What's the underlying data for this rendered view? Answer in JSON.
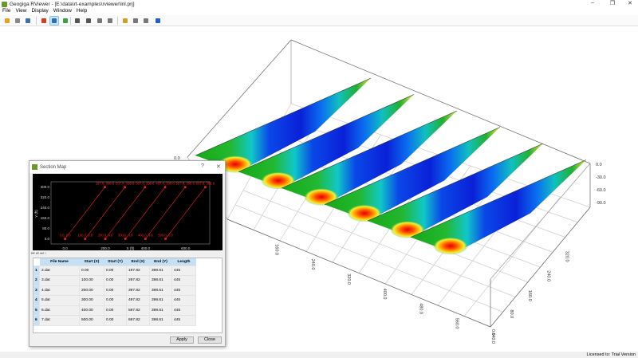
{
  "window": {
    "title": "Geogiga RViewer - [E:\\data\\rt-examples\\rviewer\\lnl.prj]",
    "minimize": "–",
    "maximize": "❐",
    "close": "✕"
  },
  "menu": [
    "File",
    "View",
    "Display",
    "Window",
    "Help"
  ],
  "toolbar": [
    {
      "name": "open-icon",
      "color": "#e8a020"
    },
    {
      "name": "print-icon",
      "color": "#888888"
    },
    {
      "name": "save-image-icon",
      "color": "#3a6fb0"
    },
    {
      "name": "color-scale-icon",
      "color": "#d04020"
    },
    {
      "name": "section-map-icon",
      "color": "#2a70c0",
      "active": true
    },
    {
      "name": "refresh-icon",
      "color": "#3aa040"
    },
    {
      "name": "zoom-in-icon",
      "color": "#555555"
    },
    {
      "name": "zoom-out-icon",
      "color": "#555555"
    },
    {
      "name": "zoom-window-icon",
      "color": "#777777"
    },
    {
      "name": "zoom-fit-icon",
      "color": "#777777"
    },
    {
      "name": "axis-icon",
      "color": "#d0a020"
    },
    {
      "name": "bt-icon",
      "color": "#777777"
    },
    {
      "name": "rt-icon",
      "color": "#777777"
    },
    {
      "name": "rotate-icon",
      "color": "#2060d0"
    }
  ],
  "view3d": {
    "x_axis_ticks": [
      "160.0",
      "240.0",
      "320.0",
      "400.0",
      "480.0",
      "560.0",
      "640.0"
    ],
    "y_axis_ticks": [
      "0.0",
      "80.0",
      "160.0",
      "240.0",
      "320.0"
    ],
    "z_axis_ticks": [
      "0.0",
      "-30.0",
      "-60.0",
      "-90.0"
    ],
    "left_label": "0.0",
    "sections": 6
  },
  "dialog": {
    "title": "Section Map",
    "help": "?",
    "close": "✕",
    "chart_data": {
      "type": "line",
      "xlabel": "X (ft)",
      "ylabel": "Y (ft)",
      "xlim": [
        -70,
        720
      ],
      "ylim": [
        -40,
        440
      ],
      "x_ticks": [
        "0.0",
        "200.0",
        "400.0",
        "600.0"
      ],
      "y_ticks": [
        "0.0",
        "80.0",
        "160.0",
        "240.0",
        "320.0",
        "400.0"
      ],
      "series": [
        {
          "x": [
            0,
            197.82
          ],
          "y": [
            0,
            398.61
          ],
          "start_label": "0.0, 0.0",
          "end_label": "197.8, 398.6"
        },
        {
          "x": [
            100,
            297.82
          ],
          "y": [
            0,
            398.61
          ],
          "start_label": "100.0, 0.0",
          "end_label": "297.8, 398.6"
        },
        {
          "x": [
            200,
            397.82
          ],
          "y": [
            0,
            398.61
          ],
          "start_label": "200.0, 0.0",
          "end_label": "397.8, 398.6"
        },
        {
          "x": [
            300,
            497.82
          ],
          "y": [
            0,
            398.61
          ],
          "start_label": "300.0, 0.0",
          "end_label": "497.8, 398.6"
        },
        {
          "x": [
            400,
            597.82
          ],
          "y": [
            0,
            398.61
          ],
          "start_label": "400.0, 0.0",
          "end_label": "597.8, 398.6"
        },
        {
          "x": [
            500,
            697.82
          ],
          "y": [
            0,
            398.61
          ],
          "start_label": "500.0, 0.0",
          "end_label": "697.8, 398.6"
        }
      ],
      "color": "#ff2020"
    },
    "table": {
      "headers": [
        "File Name",
        "Start (X)",
        "Start (Y)",
        "End (X)",
        "End (Y)",
        "Length"
      ],
      "rows": [
        [
          "1",
          "2.dat",
          "0.00",
          "0.00",
          "197.82",
          "398.61",
          "445"
        ],
        [
          "2",
          "3.dat",
          "100.00",
          "0.00",
          "297.82",
          "398.61",
          "445"
        ],
        [
          "3",
          "4.dat",
          "200.00",
          "0.00",
          "397.82",
          "398.61",
          "445"
        ],
        [
          "4",
          "5.dat",
          "300.00",
          "0.00",
          "497.82",
          "398.61",
          "445"
        ],
        [
          "5",
          "6.dat",
          "400.00",
          "0.00",
          "597.82",
          "398.61",
          "445"
        ],
        [
          "6",
          "7.dat",
          "500.00",
          "0.00",
          "697.82",
          "398.61",
          "445"
        ]
      ]
    },
    "apply": "Apply",
    "close_btn": "Close"
  },
  "status": {
    "license": "Licensed to: Trial Version"
  }
}
